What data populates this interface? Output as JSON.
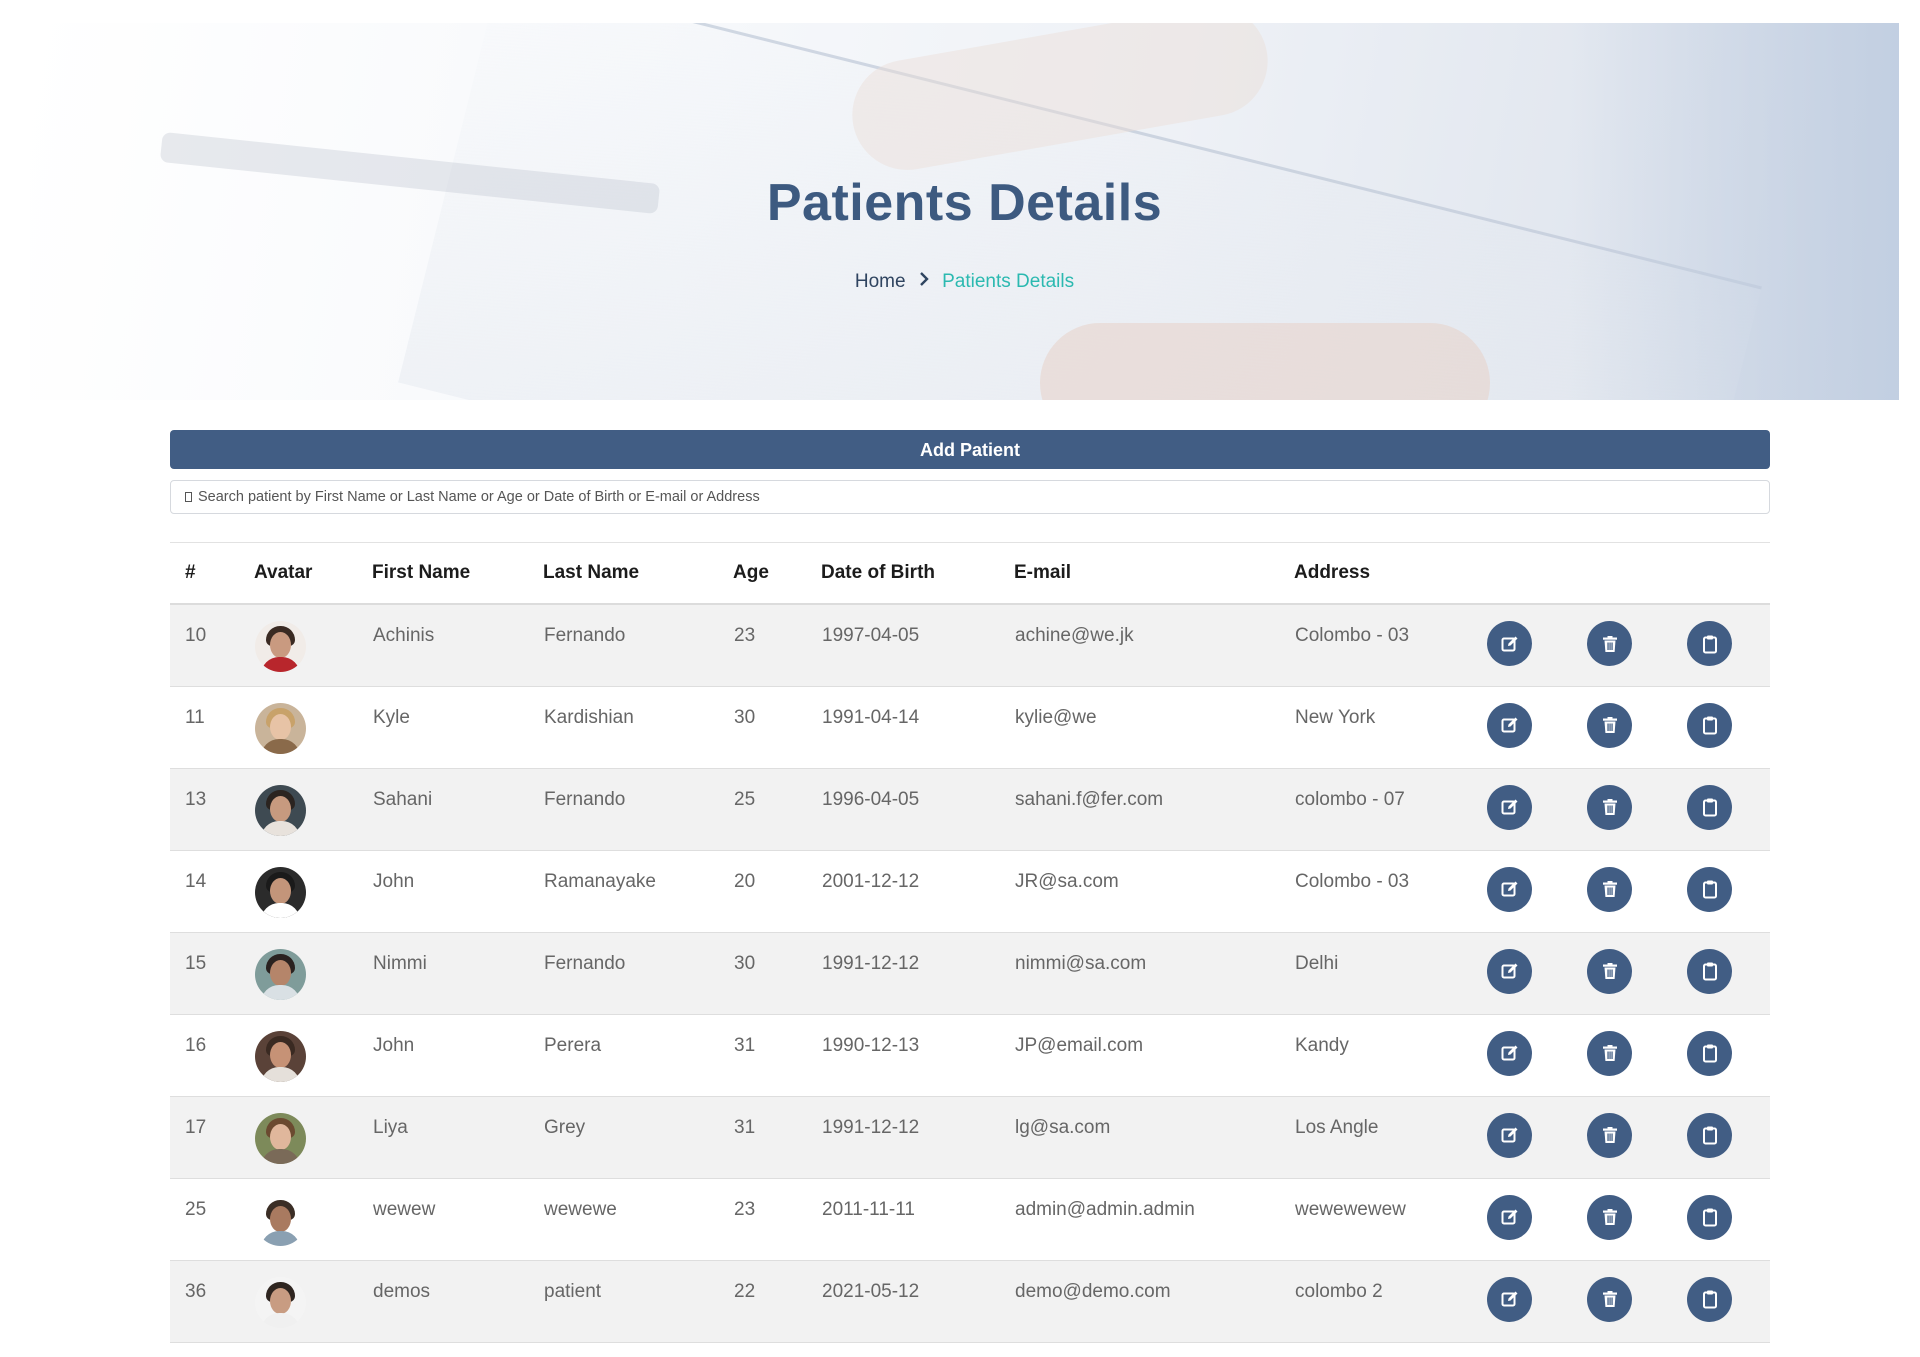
{
  "hero": {
    "title": "Patients Details",
    "breadcrumb": {
      "home": "Home",
      "current": "Patients Details"
    }
  },
  "toolbar": {
    "add_label": "Add Patient"
  },
  "search": {
    "placeholder": "Search patient by First Name or Last Name or Age or Date of Birth or E-mail or Address"
  },
  "table": {
    "columns": [
      "#",
      "Avatar",
      "First Name",
      "Last Name",
      "Age",
      "Date of Birth",
      "E-mail",
      "Address"
    ],
    "rows": [
      {
        "id": "10",
        "first": "Achinis",
        "last": "Fernando",
        "age": "23",
        "dob": "1997-04-05",
        "email": "achine@we.jk",
        "address": "Colombo - 03"
      },
      {
        "id": "11",
        "first": "Kyle",
        "last": "Kardishian",
        "age": "30",
        "dob": "1991-04-14",
        "email": "kylie@we",
        "address": "New York"
      },
      {
        "id": "13",
        "first": "Sahani",
        "last": "Fernando",
        "age": "25",
        "dob": "1996-04-05",
        "email": "sahani.f@fer.com",
        "address": "colombo - 07"
      },
      {
        "id": "14",
        "first": "John",
        "last": "Ramanayake",
        "age": "20",
        "dob": "2001-12-12",
        "email": "JR@sa.com",
        "address": "Colombo - 03"
      },
      {
        "id": "15",
        "first": "Nimmi",
        "last": "Fernando",
        "age": "30",
        "dob": "1991-12-12",
        "email": "nimmi@sa.com",
        "address": "Delhi"
      },
      {
        "id": "16",
        "first": "John",
        "last": "Perera",
        "age": "31",
        "dob": "1990-12-13",
        "email": "JP@email.com",
        "address": "Kandy"
      },
      {
        "id": "17",
        "first": "Liya",
        "last": "Grey",
        "age": "31",
        "dob": "1991-12-12",
        "email": "lg@sa.com",
        "address": "Los Angle"
      },
      {
        "id": "25",
        "first": "wewew",
        "last": "wewewe",
        "age": "23",
        "dob": "2011-11-11",
        "email": "admin@admin.admin",
        "address": "wewewewew"
      },
      {
        "id": "36",
        "first": "demos",
        "last": "patient",
        "age": "22",
        "dob": "2021-05-12",
        "email": "demo@demo.com",
        "address": "colombo 2"
      }
    ]
  },
  "colors": {
    "primary": "#415d84",
    "accent": "#2bb9b0",
    "title": "#3d5a80"
  },
  "icons": {
    "edit": "edit-icon",
    "delete": "trash-icon",
    "report": "clipboard-icon",
    "search": "search-icon",
    "breadcrumb_sep": "chevron-right-icon"
  }
}
